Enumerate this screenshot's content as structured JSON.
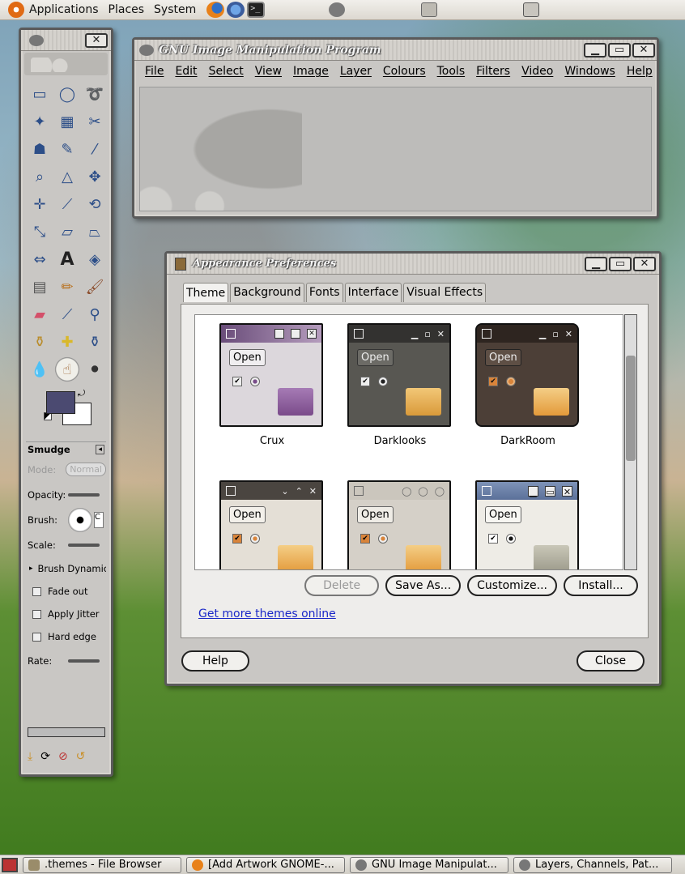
{
  "top_panel": {
    "menus": [
      "Applications",
      "Places",
      "System"
    ]
  },
  "gimp_main": {
    "title": "GNU Image Manipulation Program",
    "menus": [
      "File",
      "Edit",
      "Select",
      "View",
      "Image",
      "Layer",
      "Colours",
      "Tools",
      "Filters",
      "Video",
      "Windows",
      "Help"
    ]
  },
  "toolbox": {
    "tool_name": "Smudge",
    "mode_label": "Mode:",
    "mode_value": "Normal",
    "opacity_label": "Opacity:",
    "brush_label": "Brush:",
    "brush_box_text": "C",
    "scale_label": "Scale:",
    "brush_dynamics_label": "Brush Dynamic",
    "fade_out_label": "Fade out",
    "apply_jitter_label": "Apply Jitter",
    "hard_edge_label": "Hard edge",
    "rate_label": "Rate:"
  },
  "appearance": {
    "title": "Appearance Preferences",
    "tabs": [
      "Theme",
      "Background",
      "Fonts",
      "Interface",
      "Visual Effects"
    ],
    "active_tab": "Theme",
    "themes": [
      {
        "name": "Crux",
        "open_label": "Open"
      },
      {
        "name": "Darklooks",
        "open_label": "Open"
      },
      {
        "name": "DarkRoom",
        "open_label": "Open"
      },
      {
        "name": "",
        "open_label": "Open"
      },
      {
        "name": "",
        "open_label": "Open"
      },
      {
        "name": "",
        "open_label": "Open"
      }
    ],
    "buttons": {
      "delete": "Delete",
      "save_as": "Save As...",
      "customize": "Customize...",
      "install": "Install..."
    },
    "link": "Get more themes online",
    "help": "Help",
    "close": "Close"
  },
  "taskbar": {
    "tasks": [
      ".themes - File Browser",
      "[Add Artwork GNOME-...",
      "GNU Image Manipulat...",
      "Layers, Channels, Pat..."
    ]
  },
  "colors": {
    "fg_color": "#4b4a71",
    "bg_color": "#ffffff",
    "link_color": "#1a28c8"
  }
}
